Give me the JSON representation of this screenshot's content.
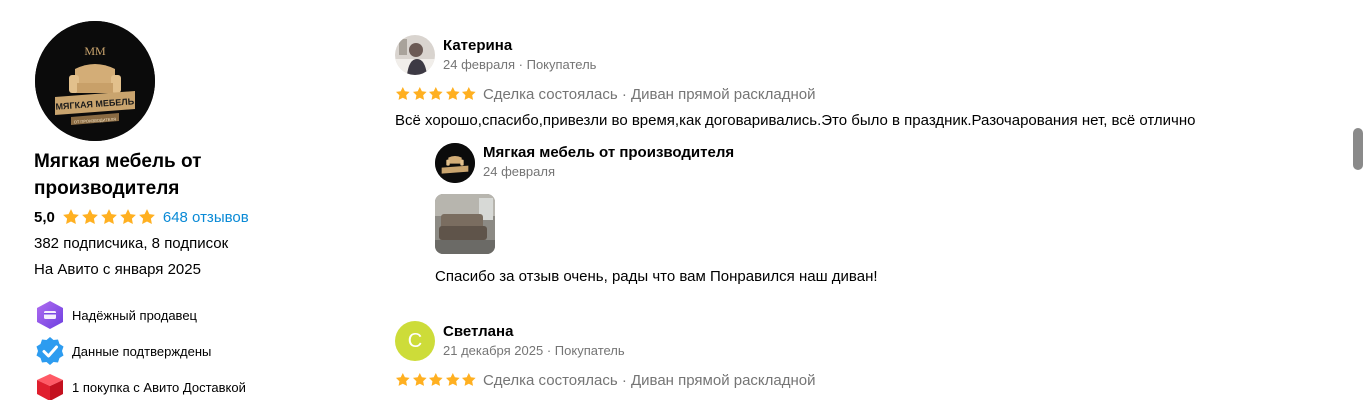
{
  "seller": {
    "logo_text_top": "MM",
    "logo_text_ribbon": "МЯГКАЯ МЕБЕЛЬ",
    "logo_text_small": "ОТ ПРОИЗВОДИТЕЛЯ",
    "name": "Мягкая мебель от производителя",
    "rating": "5,0",
    "rating_stars": 5,
    "reviews_link": "648 отзывов",
    "subscriptions": "382 подписчика, 8 подписок",
    "since": "На Авито с января 2025",
    "badges": [
      {
        "icon": "shield-badge-icon",
        "label": "Надёжный продавец"
      },
      {
        "icon": "verified-check-icon",
        "label": "Данные подтверждены"
      },
      {
        "icon": "delivery-box-icon",
        "label": "1 покупка с Авито Доставкой"
      }
    ]
  },
  "reviews": [
    {
      "author": "Катерина",
      "date": "24 февраля",
      "role": "Покупатель",
      "stars": 5,
      "deal": "Сделка состоялась",
      "item": "Диван прямой раскладной",
      "separator": "·",
      "text": "Всё хорошо,спасибо,привезли во время,как договаривались.Это было в праздник.Разочарования нет, всё отлично",
      "reply": {
        "author": "Мягкая мебель от производителя",
        "date": "24 февраля",
        "text": "Спасибо за отзыв очень, рады что вам Понравился наш диван!"
      }
    },
    {
      "author": "Светлана",
      "avatar_letter": "С",
      "date": "21 декабря 2025",
      "role": "Покупатель",
      "stars": 5,
      "deal": "Сделка состоялась",
      "item": "Диван прямой раскладной",
      "separator": "·"
    }
  ],
  "colors": {
    "star": "#ffb021",
    "link": "#0a8ad6",
    "muted": "#757575",
    "avatar_letter_bg": "#cddc39"
  }
}
